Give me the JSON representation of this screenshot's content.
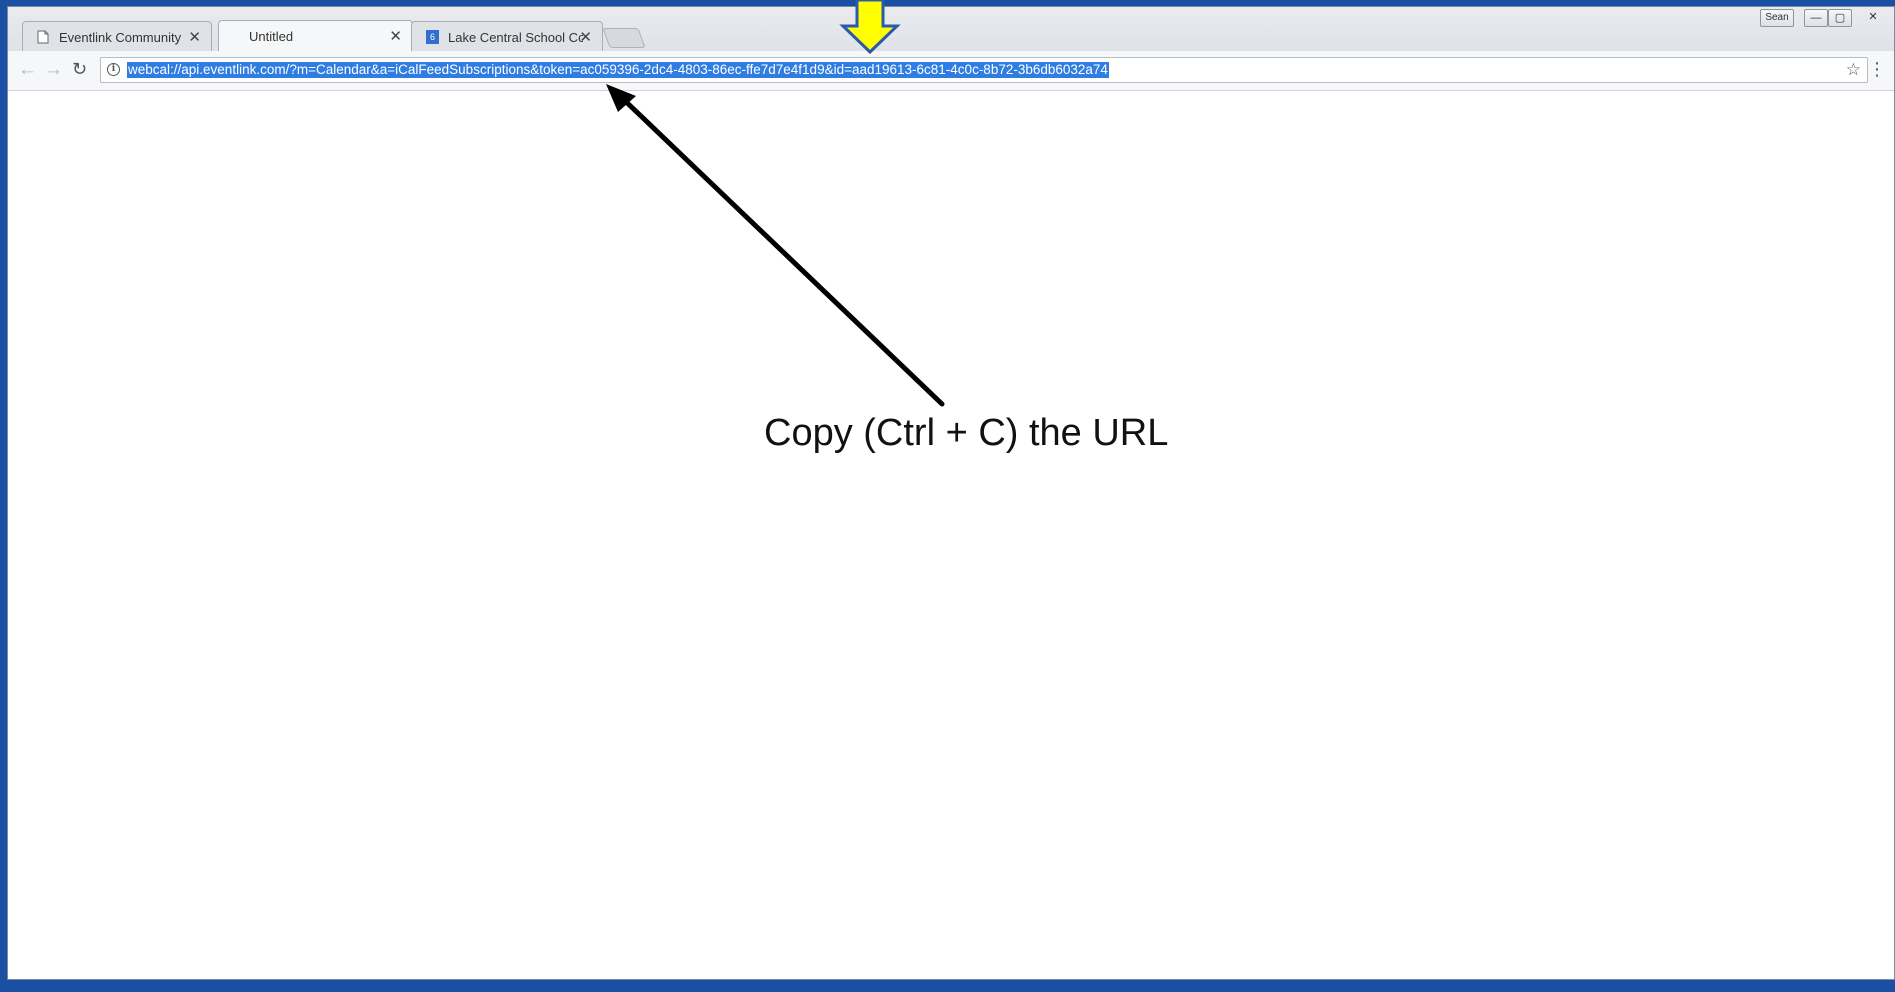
{
  "tabs": [
    {
      "label": "Eventlink Community",
      "icon": "page-icon",
      "active": false
    },
    {
      "label": "Untitled",
      "icon": "",
      "active": true
    },
    {
      "label": "Lake Central School Corp",
      "icon": "calendar-favicon",
      "favicon_text": "6",
      "active": false
    }
  ],
  "window_controls": {
    "user_label": "Sean",
    "minimize": "—",
    "maximize": "▢",
    "close": "✕"
  },
  "toolbar": {
    "url": "webcal://api.eventlink.com/?m=Calendar&a=iCalFeedSubscriptions&token=ac059396-2dc4-4803-86ec-ffe7d7e4f1d9&id=aad19613-6c81-4c0c-8b72-3b6db6032a74",
    "url_selected": true,
    "info_icon": "info-icon",
    "star_icon": "star-icon",
    "menu_icon": "kebab-menu-icon"
  },
  "annotation": {
    "text": "Copy (Ctrl + C) the URL"
  },
  "colors": {
    "selection": "#2f7de1",
    "desktop": "#1a4fa3",
    "highlight_arrow": "#ffff00",
    "highlight_arrow_border": "#2a5aa8"
  }
}
